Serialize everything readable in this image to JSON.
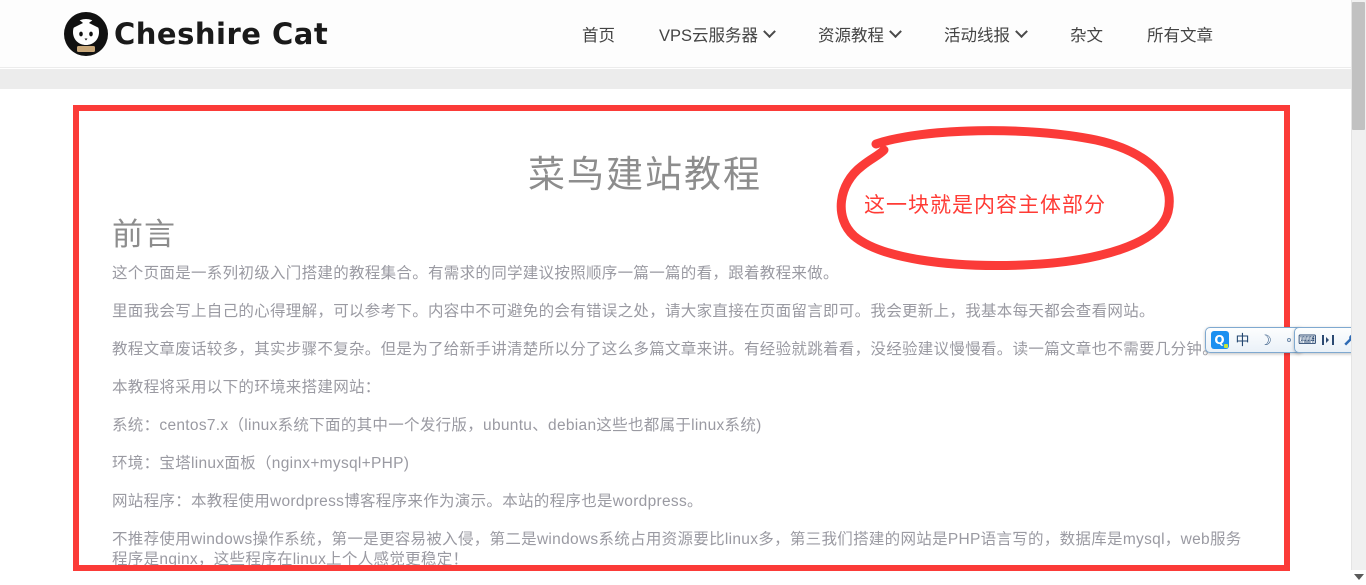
{
  "header": {
    "logo_text": "Cheshire Cat",
    "logo_icon": "cat-face-logo",
    "nav": [
      {
        "label": "首页",
        "has_dropdown": false
      },
      {
        "label": "VPS云服务器",
        "has_dropdown": true
      },
      {
        "label": "资源教程",
        "has_dropdown": true
      },
      {
        "label": "活动线报",
        "has_dropdown": true
      },
      {
        "label": "杂文",
        "has_dropdown": false
      },
      {
        "label": "所有文章",
        "has_dropdown": false
      }
    ]
  },
  "article": {
    "title": "菜鸟建站教程",
    "section_heading": "前言",
    "paragraphs": [
      "这个页面是一系列初级入门搭建的教程集合。有需求的同学建议按照顺序一篇一篇的看，跟着教程来做。",
      "里面我会写上自己的心得理解，可以参考下。内容中不可避免的会有错误之处，请大家直接在页面留言即可。我会更新上，我基本每天都会查看网站。",
      "教程文章废话较多，其实步骤不复杂。但是为了给新手讲清楚所以分了这么多篇文章来讲。有经验就跳着看，没经验建议慢慢看。读一篇文章也不需要几分钟。",
      "本教程将采用以下的环境来搭建网站：",
      "系统：centos7.x（linux系统下面的其中一个发行版，ubuntu、debian这些也都属于linux系统)",
      "环境：宝塔linux面板（nginx+mysql+PHP)",
      "网站程序：本教程使用wordpress博客程序来作为演示。本站的程序也是wordpress。",
      "不推荐使用windows操作系统，第一是更容易被入侵，第二是windows系统占用资源要比linux多，第三我们搭建的网站是PHP语言写的，数据库是mysql，web服务程序是nginx，这些程序在linux上个人感觉更稳定！"
    ]
  },
  "annotation": {
    "text": "这一块就是内容主体部分",
    "color": "#ff3b35",
    "box_color": "#fb3b38",
    "shape": "hand-drawn-ellipse"
  },
  "ime_toolbar": {
    "logo_letter": "Q",
    "mode_label": "中",
    "moon_glyph": "☽",
    "dot_glyph": "∘",
    "keyboard_glyph": "⌨",
    "toolbox_glyph": "⚏",
    "wrench_glyph": "🔧"
  },
  "scrollbar": {
    "down_arrow": "▼"
  },
  "colors": {
    "text_body": "#9a9aa2",
    "heading": "#8d8d8d",
    "nav_text": "#444444",
    "accent_red": "#fb3b38",
    "grey_band": "#ececec"
  }
}
